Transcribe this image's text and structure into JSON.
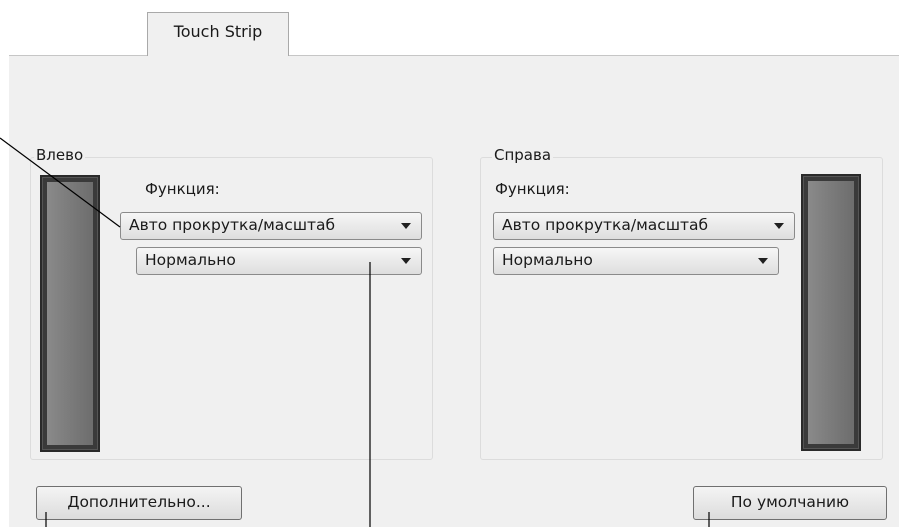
{
  "tabs": [
    {
      "label": "Touch Strip",
      "selected": true
    }
  ],
  "left_group": {
    "title": "Влево",
    "function_label": "Функция:",
    "function_select": {
      "value": "Авто прокрутка/масштаб"
    },
    "speed_select": {
      "value": "Нормально"
    }
  },
  "right_group": {
    "title": "Справа",
    "function_label": "Функция:",
    "function_select": {
      "value": "Авто прокрутка/масштаб"
    },
    "speed_select": {
      "value": "Нормально"
    }
  },
  "buttons": {
    "advanced": "Дополнительно...",
    "defaults": "По умолчанию"
  },
  "icons": {
    "dropdown": "chevron-down-icon",
    "touch_strip": "touch-strip-icon"
  },
  "colors": {
    "panel_bg": "#f0f0f0",
    "strip_frame": "#3a3a3a",
    "strip_surface": "#7b7b7b"
  }
}
